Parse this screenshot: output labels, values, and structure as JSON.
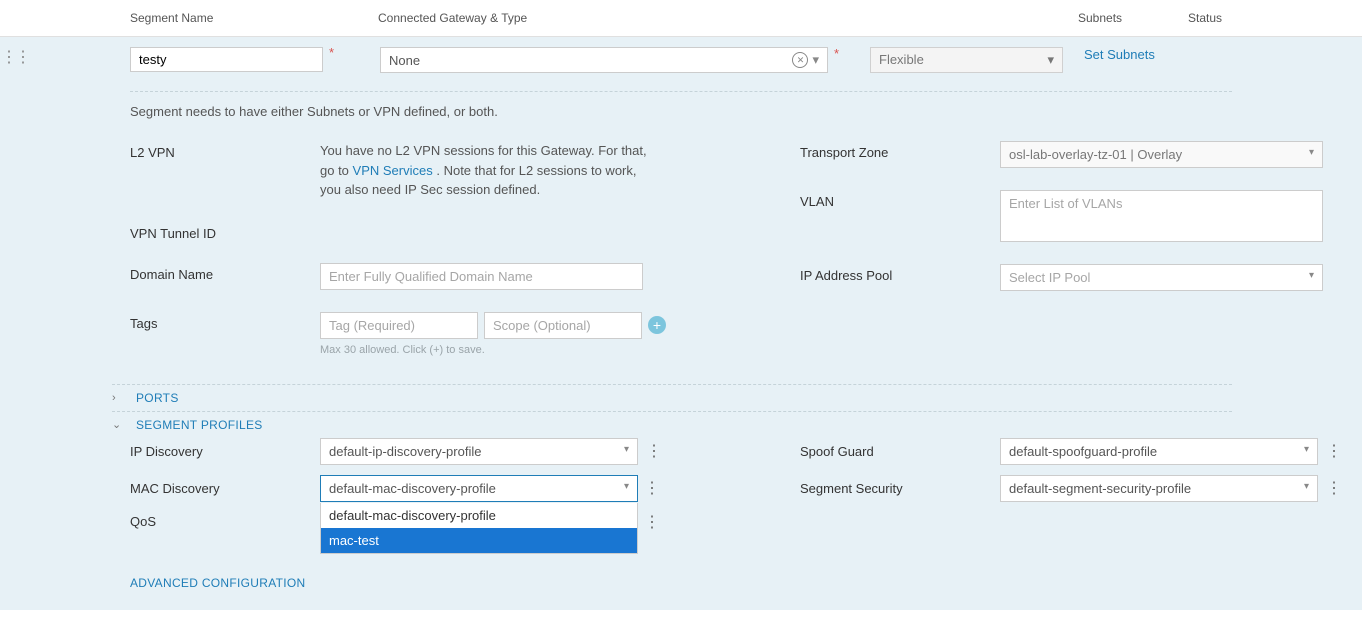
{
  "header": {
    "segment_name": "Segment Name",
    "gateway_type": "Connected Gateway & Type",
    "subnets": "Subnets",
    "status": "Status"
  },
  "edit": {
    "segment_name_value": "testy",
    "gateway_value": "None",
    "type_value": "Flexible",
    "set_subnets": "Set Subnets"
  },
  "hint": "Segment needs to have either Subnets or VPN defined, or both.",
  "l2vpn": {
    "label": "L2 VPN",
    "text_a": "You have no L2 VPN sessions for this Gateway. For that, go to ",
    "link": "VPN Services",
    "text_b": " . Note that for L2 sessions to work, you also need IP Sec session defined."
  },
  "vpn_tunnel": {
    "label": "VPN Tunnel ID"
  },
  "domain": {
    "label": "Domain Name",
    "placeholder": "Enter Fully Qualified Domain Name"
  },
  "tags": {
    "label": "Tags",
    "tag_ph": "Tag (Required)",
    "scope_ph": "Scope (Optional)",
    "hint": "Max 30 allowed. Click (+) to save."
  },
  "tz": {
    "label": "Transport Zone",
    "value": "osl-lab-overlay-tz-01 | Overlay"
  },
  "vlan": {
    "label": "VLAN",
    "placeholder": "Enter List of VLANs"
  },
  "ippool": {
    "label": "IP Address Pool",
    "placeholder": "Select IP Pool"
  },
  "sections": {
    "ports": "PORTS",
    "profiles": "SEGMENT PROFILES",
    "advanced": "ADVANCED CONFIGURATION"
  },
  "profiles": {
    "ip_discovery": {
      "label": "IP Discovery",
      "value": "default-ip-discovery-profile"
    },
    "mac_discovery": {
      "label": "MAC Discovery",
      "value": "default-mac-discovery-profile",
      "options": [
        "default-mac-discovery-profile",
        "mac-test"
      ],
      "selected_index": 1
    },
    "qos": {
      "label": "QoS"
    },
    "spoof_guard": {
      "label": "Spoof Guard",
      "value": "default-spoofguard-profile"
    },
    "segment_security": {
      "label": "Segment Security",
      "value": "default-segment-security-profile"
    }
  }
}
